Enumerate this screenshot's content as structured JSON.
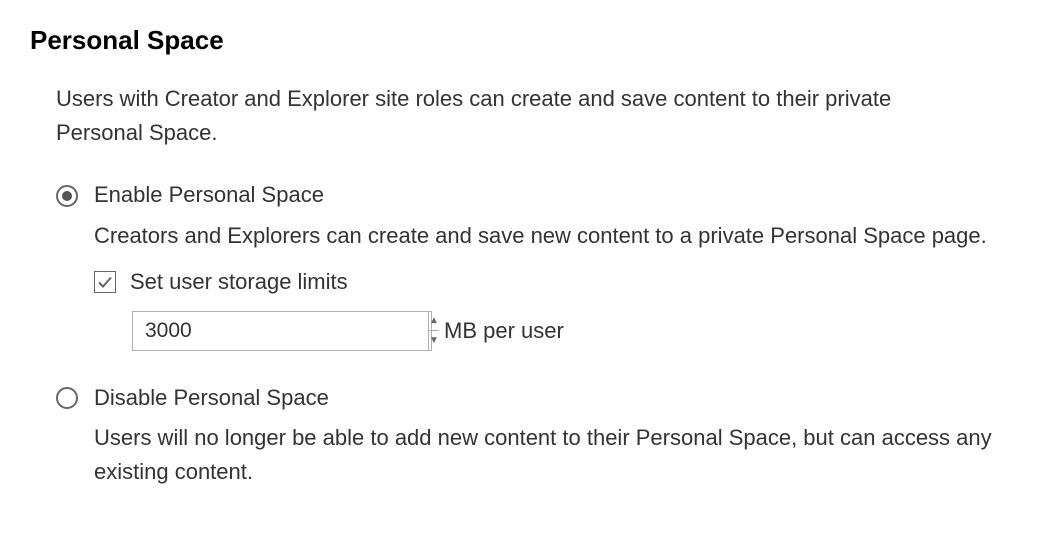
{
  "section": {
    "title": "Personal Space",
    "description": "Users with Creator and Explorer site roles can create and save content to their private Personal Space."
  },
  "options": {
    "enable": {
      "label": "Enable Personal Space",
      "description": "Creators and Explorers can create and save new content to a private Personal Space page.",
      "selected": true,
      "storage_limits": {
        "label": "Set user storage limits",
        "checked": true,
        "value": "3000",
        "unit": "MB per user"
      }
    },
    "disable": {
      "label": "Disable Personal Space",
      "description": "Users will no longer be able to add new content to their Personal Space, but can access any existing content.",
      "selected": false
    }
  }
}
